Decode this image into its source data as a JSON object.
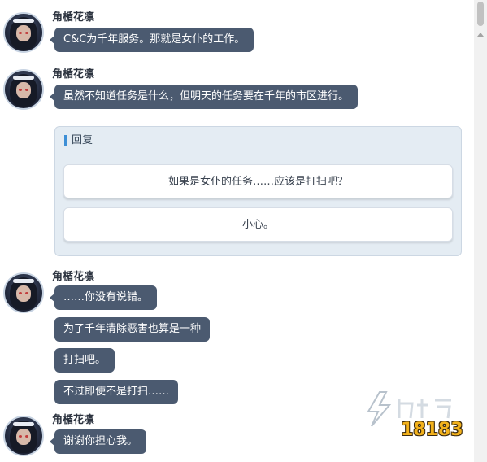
{
  "messages": [
    {
      "speaker": "角楯花凛",
      "lines": [
        "C&C为千年服务。那就是女仆的工作。"
      ]
    },
    {
      "speaker": "角楯花凛",
      "lines": [
        "虽然不知道任务是什么，但明天的任务要在千年的市区进行。"
      ]
    },
    {
      "speaker": "角楯花凛",
      "lines": [
        "……你没有说错。",
        "为了千年清除恶害也算是一种",
        "打扫吧。",
        "不过即使不是打扫……"
      ]
    },
    {
      "speaker": "角楯花凛",
      "lines": [
        "谢谢你担心我。"
      ]
    }
  ],
  "reply": {
    "title": "回复",
    "options": [
      "如果是女仆的任务……应该是打扫吧？",
      "小心。"
    ]
  },
  "watermark": {
    "text": "18183",
    "brand": "九游"
  },
  "colors": {
    "bubble": "#4b5a70",
    "reply_bg": "#e4ecf3",
    "accent": "#3d8fd6"
  }
}
